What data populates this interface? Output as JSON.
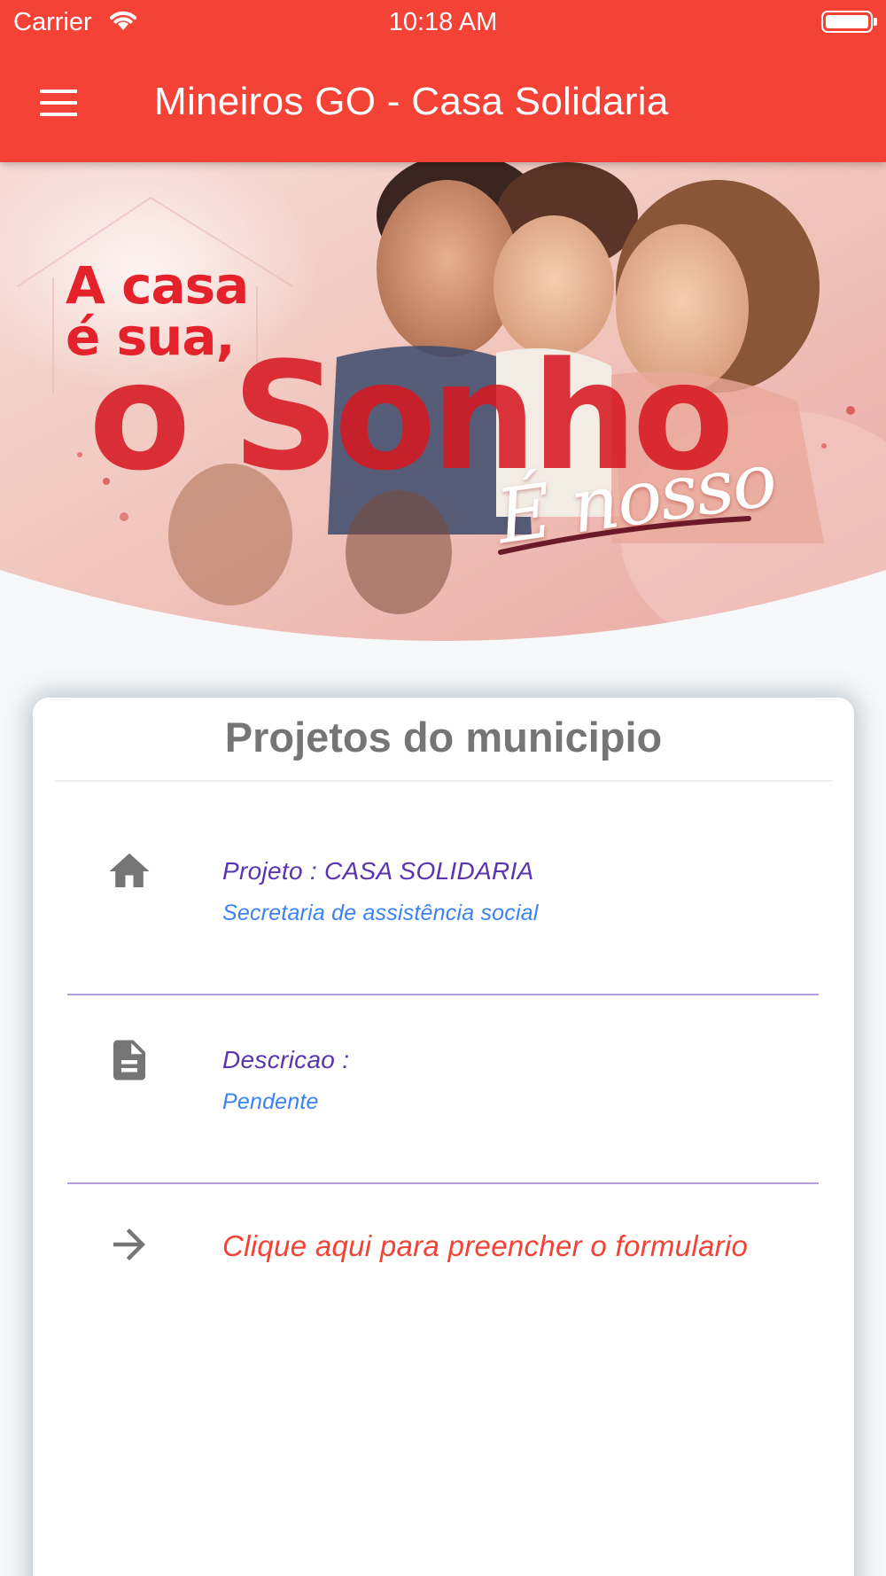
{
  "status_bar": {
    "carrier": "Carrier",
    "time": "10:18 AM"
  },
  "app_bar": {
    "title": "Mineiros GO - Casa Solidaria",
    "menu_icon": "menu-icon"
  },
  "banner": {
    "line1": "A casa",
    "line2": "é sua,",
    "headline": "o Sonho",
    "tagline": "É nosso"
  },
  "card": {
    "title": "Projetos do municipio",
    "items": [
      {
        "icon": "home-icon",
        "title": "Projeto : CASA SOLIDARIA",
        "subtitle": "Secretaria de assistência social"
      },
      {
        "icon": "document-icon",
        "title": "Descricao :",
        "subtitle": "Pendente"
      }
    ],
    "action": {
      "icon": "arrow-forward-icon",
      "label": "Clique aqui para preencher o formulario"
    }
  },
  "colors": {
    "primary": "#f44336",
    "title_text": "#757575",
    "item_title": "#5a35b0",
    "item_subtitle": "#3b82f6",
    "divider": "#b39ddb"
  }
}
